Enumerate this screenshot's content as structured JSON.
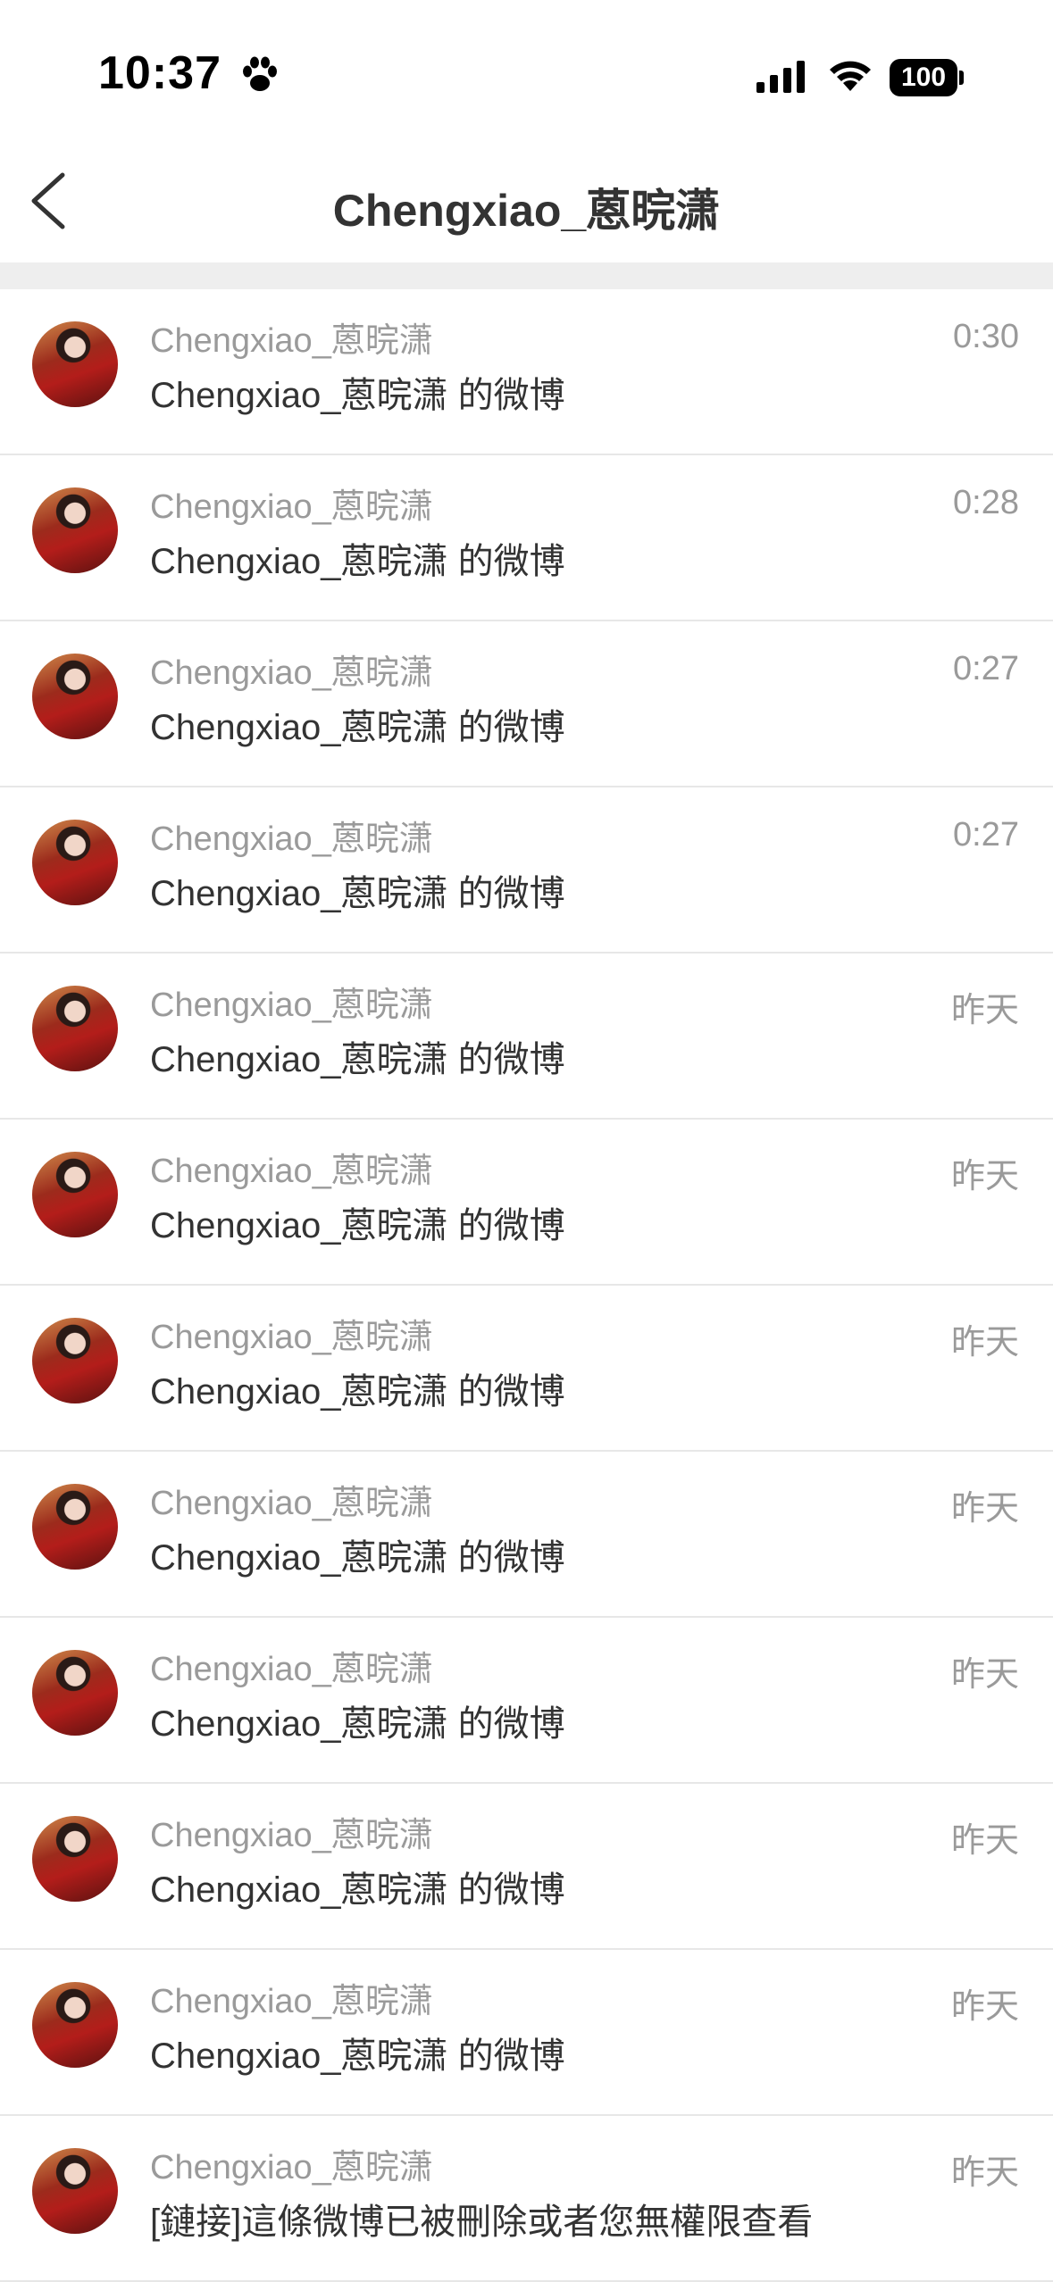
{
  "status_bar": {
    "time": "10:37",
    "battery": "100"
  },
  "nav": {
    "title": "Chengxiao_蒽晥潇"
  },
  "messages": [
    {
      "sender": "Chengxiao_蒽晥潇",
      "preview": "Chengxiao_蒽晥潇 的微博",
      "time": "0:30"
    },
    {
      "sender": "Chengxiao_蒽晥潇",
      "preview": "Chengxiao_蒽晥潇 的微博",
      "time": "0:28"
    },
    {
      "sender": "Chengxiao_蒽晥潇",
      "preview": "Chengxiao_蒽晥潇 的微博",
      "time": "0:27"
    },
    {
      "sender": "Chengxiao_蒽晥潇",
      "preview": "Chengxiao_蒽晥潇 的微博",
      "time": "0:27"
    },
    {
      "sender": "Chengxiao_蒽晥潇",
      "preview": "Chengxiao_蒽晥潇 的微博",
      "time": "昨天"
    },
    {
      "sender": "Chengxiao_蒽晥潇",
      "preview": "Chengxiao_蒽晥潇 的微博",
      "time": "昨天"
    },
    {
      "sender": "Chengxiao_蒽晥潇",
      "preview": "Chengxiao_蒽晥潇 的微博",
      "time": "昨天"
    },
    {
      "sender": "Chengxiao_蒽晥潇",
      "preview": "Chengxiao_蒽晥潇 的微博",
      "time": "昨天"
    },
    {
      "sender": "Chengxiao_蒽晥潇",
      "preview": "Chengxiao_蒽晥潇 的微博",
      "time": "昨天"
    },
    {
      "sender": "Chengxiao_蒽晥潇",
      "preview": "Chengxiao_蒽晥潇 的微博",
      "time": "昨天"
    },
    {
      "sender": "Chengxiao_蒽晥潇",
      "preview": "Chengxiao_蒽晥潇 的微博",
      "time": "昨天"
    },
    {
      "sender": "Chengxiao_蒽晥潇",
      "preview": "[鏈接]這條微博已被刪除或者您無權限查看",
      "time": "昨天"
    }
  ]
}
